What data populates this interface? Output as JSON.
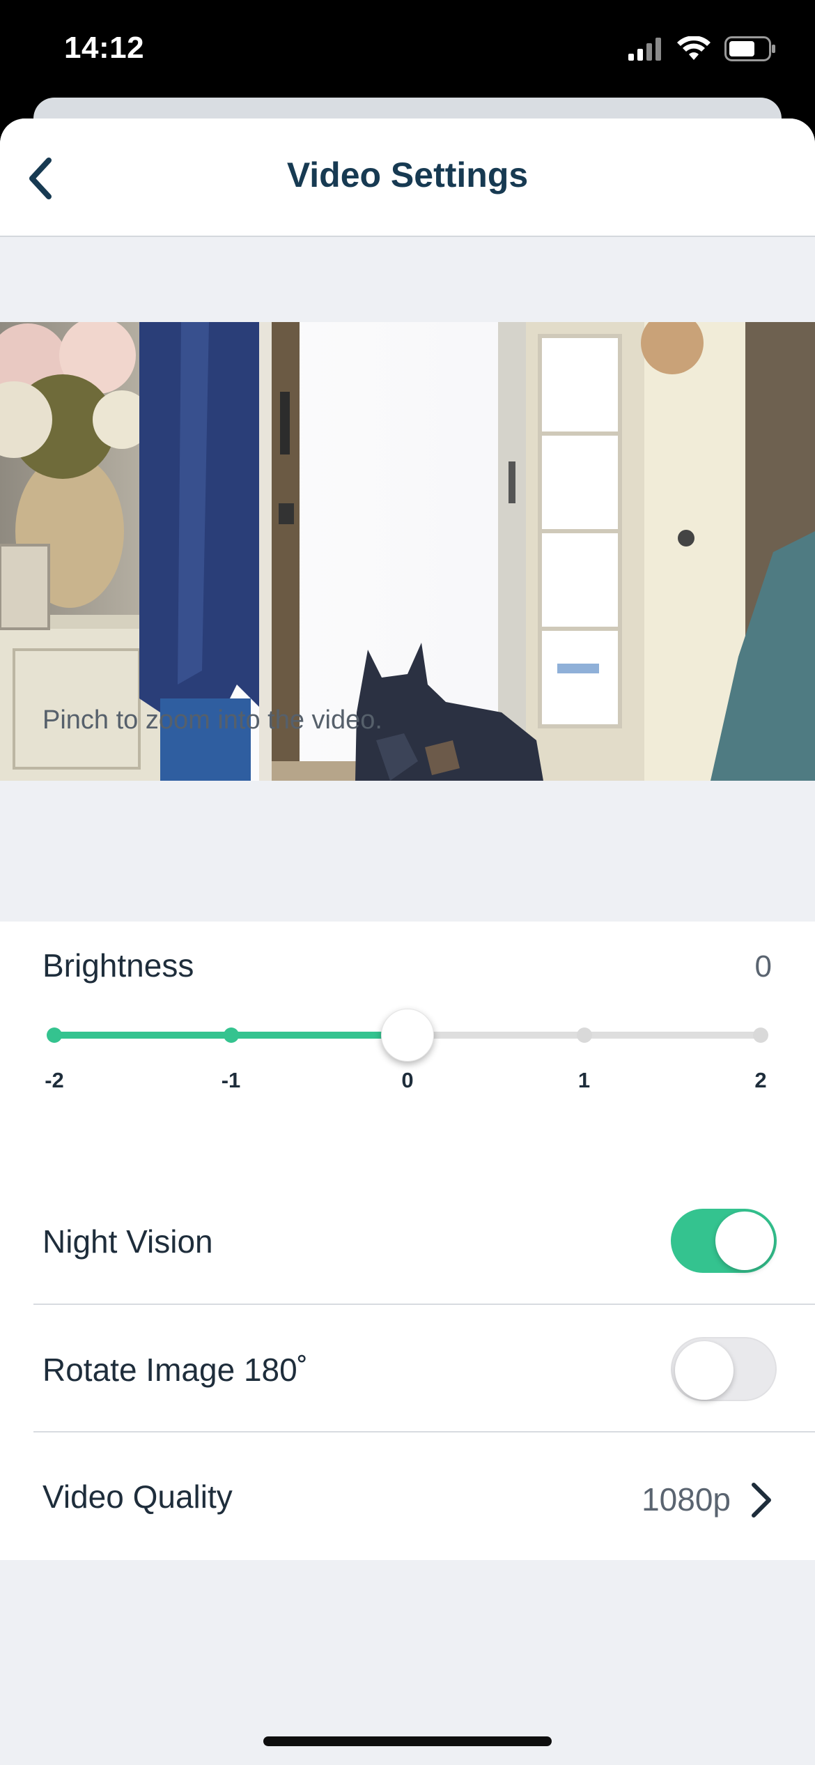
{
  "status_bar": {
    "time": "14:12",
    "signal_icon": "cellular-signal-icon",
    "wifi_icon": "wifi-icon",
    "battery_icon": "battery-icon"
  },
  "nav": {
    "back_icon": "chevron-left-icon",
    "title": "Video Settings"
  },
  "video": {
    "description": "Live camera preview"
  },
  "hint": "Pinch to zoom into the video.",
  "brightness": {
    "label": "Brightness",
    "value": "0",
    "ticks": [
      "-2",
      "-1",
      "0",
      "1",
      "2"
    ],
    "selected_index": 2,
    "accent": "#34c38f"
  },
  "settings": {
    "night_vision": {
      "label": "Night Vision",
      "enabled": true
    },
    "rotate_image": {
      "label": "Rotate Image 180˚",
      "enabled": false
    },
    "video_quality": {
      "label": "Video Quality",
      "value": "1080p",
      "icon": "chevron-right-icon"
    }
  },
  "colors": {
    "title": "#173a52",
    "accent": "#34c38f",
    "background": "#eef0f4"
  }
}
